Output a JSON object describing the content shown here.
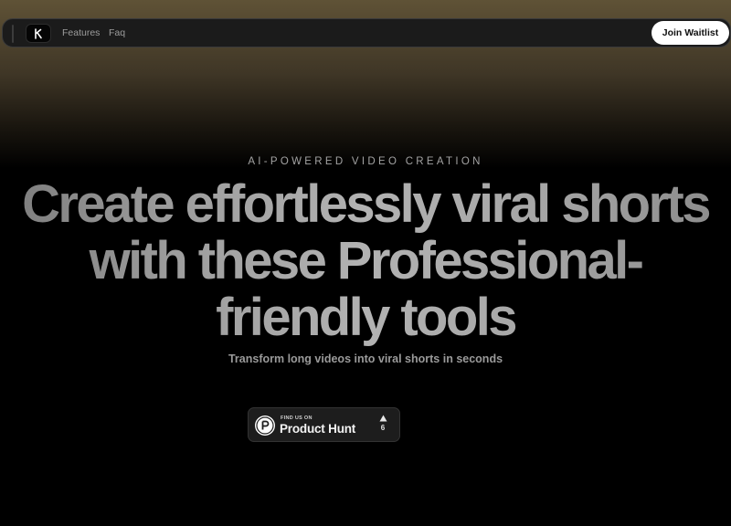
{
  "nav": {
    "logo_icon": "stylized-k-logo-icon",
    "links": [
      {
        "label": "Features"
      },
      {
        "label": "Faq"
      }
    ],
    "cta_label": "Join Waitlist"
  },
  "hero": {
    "eyebrow": "AI-POWERED VIDEO CREATION",
    "headline_lines": [
      "Create effortlessly viral shorts",
      "with these Professional-",
      "friendly tools"
    ],
    "subtitle": "Transform long videos into viral shorts in seconds"
  },
  "product_hunt": {
    "small_label": "FIND US ON",
    "name": "Product Hunt",
    "vote_icon": "upvote-triangle-icon",
    "vote_count": "6"
  },
  "colors": {
    "top_glow": "#5f5236",
    "background": "#000000",
    "nav_bg": "#1b1b1b",
    "cta_bg": "#ffffff"
  }
}
